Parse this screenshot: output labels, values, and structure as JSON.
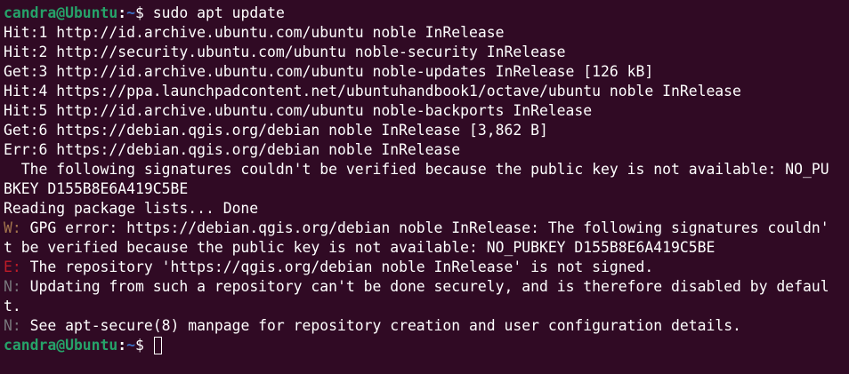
{
  "terminal": {
    "prompt": {
      "user_host": "candra@Ubuntu",
      "colon": ":",
      "path": "~",
      "dollar": "$ "
    },
    "command": "sudo apt update",
    "lines": [
      "Hit:1 http://id.archive.ubuntu.com/ubuntu noble InRelease",
      "Hit:2 http://security.ubuntu.com/ubuntu noble-security InRelease",
      "Get:3 http://id.archive.ubuntu.com/ubuntu noble-updates InRelease [126 kB]",
      "Hit:4 https://ppa.launchpadcontent.net/ubuntuhandbook1/octave/ubuntu noble InRelease",
      "Hit:5 http://id.archive.ubuntu.com/ubuntu noble-backports InRelease",
      "Get:6 https://debian.qgis.org/debian noble InRelease [3,862 B]",
      "Err:6 https://debian.qgis.org/debian noble InRelease",
      "  The following signatures couldn't be verified because the public key is not available: NO_PU",
      "BKEY D155B8E6A419C5BE",
      "Reading package lists... Done"
    ],
    "warning": {
      "tag": "W:",
      "line1": " GPG error: https://debian.qgis.org/debian noble InRelease: The following signatures couldn'",
      "line2": "t be verified because the public key is not available: NO_PUBKEY D155B8E6A419C5BE"
    },
    "error": {
      "tag": "E:",
      "text": " The repository 'https://qgis.org/debian noble InRelease' is not signed."
    },
    "notice1": {
      "tag": "N:",
      "line1": " Updating from such a repository can't be done securely, and is therefore disabled by defaul",
      "line2": "t."
    },
    "notice2": {
      "tag": "N:",
      "text": " See apt-secure(8) manpage for repository creation and user configuration details."
    },
    "colors": {
      "background": "#300a24",
      "prompt_user": "#26a269",
      "prompt_path": "#3b6fc4",
      "warning_tag": "#a2734c",
      "error_tag": "#c01c28",
      "notice_tag": "#77767b"
    }
  }
}
